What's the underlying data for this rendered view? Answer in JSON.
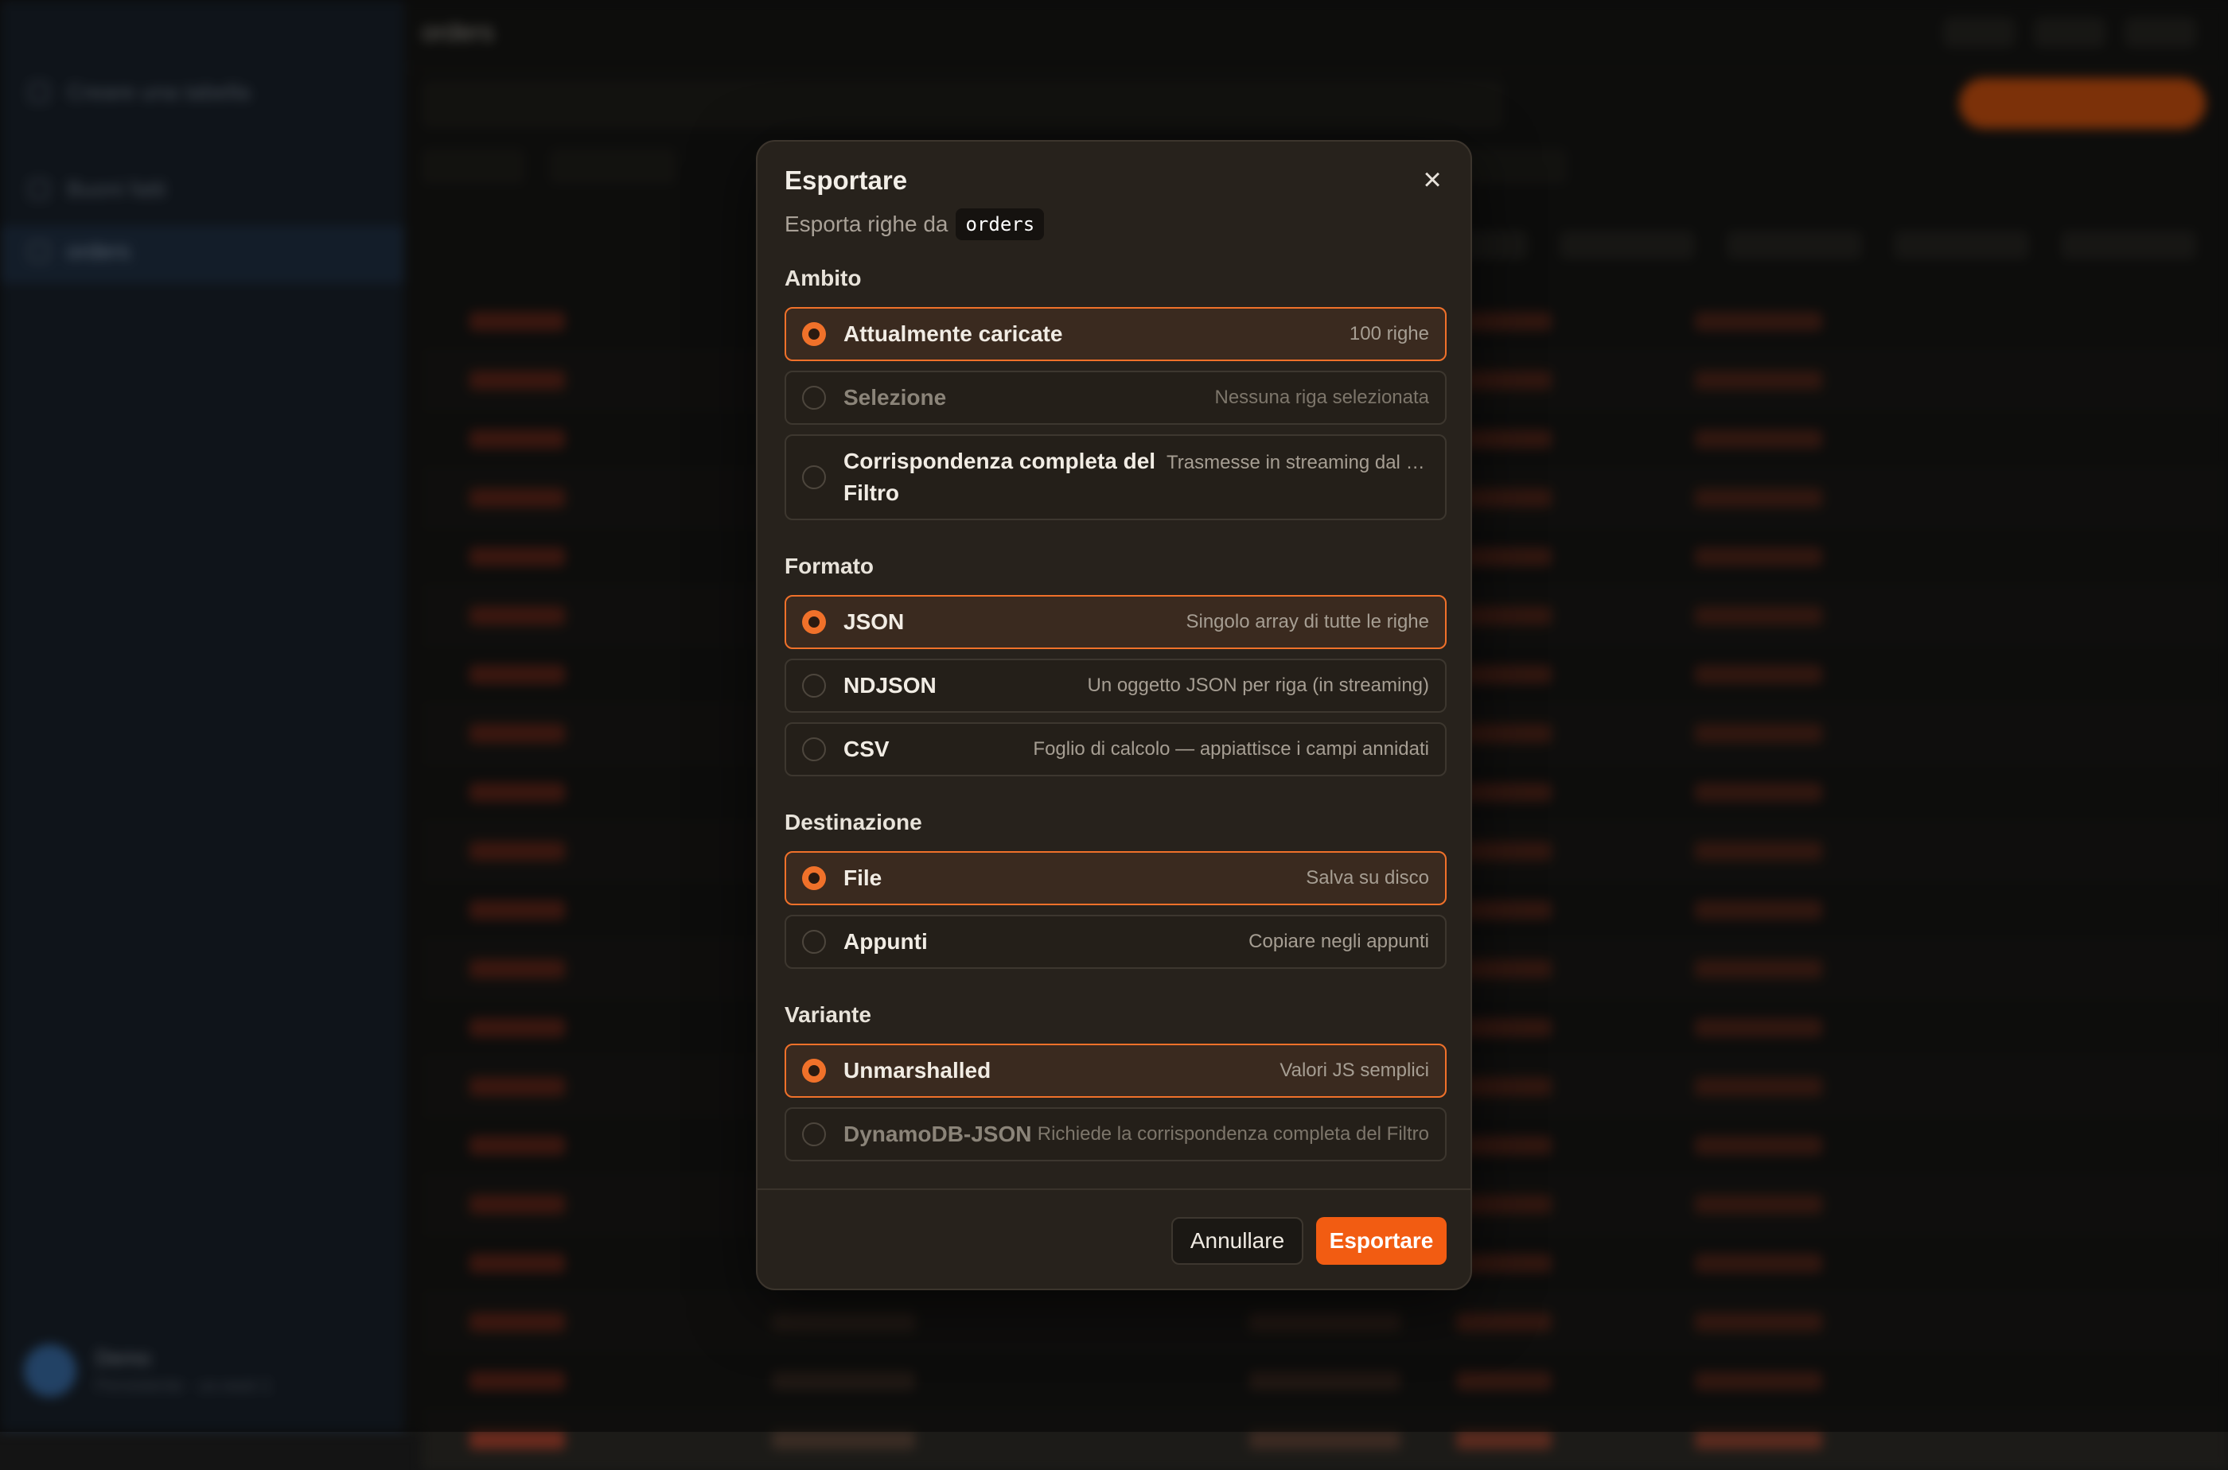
{
  "background": {
    "sidebar_items": [
      "Creare una tabella",
      "Buoni fatti",
      "orders"
    ],
    "user_name": "Demo",
    "user_sub": "Persistente · us-east-1",
    "table_title": "orders"
  },
  "dialog": {
    "title": "Esportare",
    "subtitle_prefix": "Esporta righe da",
    "table_name": "orders",
    "close_icon": "×",
    "sections": {
      "scope": {
        "label": "Ambito",
        "options": [
          {
            "label": "Attualmente caricate",
            "desc": "100 righe",
            "selected": true,
            "disabled": false
          },
          {
            "label": "Selezione",
            "desc": "Nessuna riga selezionata",
            "selected": false,
            "disabled": true
          },
          {
            "label": "Corrispondenza completa del Filtro",
            "desc": "Trasmesse in streaming dal s…",
            "selected": false,
            "disabled": false
          }
        ]
      },
      "format": {
        "label": "Formato",
        "options": [
          {
            "label": "JSON",
            "desc": "Singolo array di tutte le righe",
            "selected": true,
            "disabled": false
          },
          {
            "label": "NDJSON",
            "desc": "Un oggetto JSON per riga (in streaming)",
            "selected": false,
            "disabled": false
          },
          {
            "label": "CSV",
            "desc": "Foglio di calcolo — appiattisce i campi annidati",
            "selected": false,
            "disabled": false
          }
        ]
      },
      "destination": {
        "label": "Destinazione",
        "options": [
          {
            "label": "File",
            "desc": "Salva su disco",
            "selected": true,
            "disabled": false
          },
          {
            "label": "Appunti",
            "desc": "Copiare negli appunti",
            "selected": false,
            "disabled": false
          }
        ]
      },
      "variant": {
        "label": "Variante",
        "options": [
          {
            "label": "Unmarshalled",
            "desc": "Valori JS semplici",
            "selected": true,
            "disabled": false
          },
          {
            "label": "DynamoDB-JSON",
            "desc": "Richiede la corrispondenza completa del Filtro",
            "selected": false,
            "disabled": true
          }
        ]
      }
    },
    "buttons": {
      "cancel": "Annullare",
      "export": "Esportare"
    },
    "accent_color": "#f0712a"
  }
}
